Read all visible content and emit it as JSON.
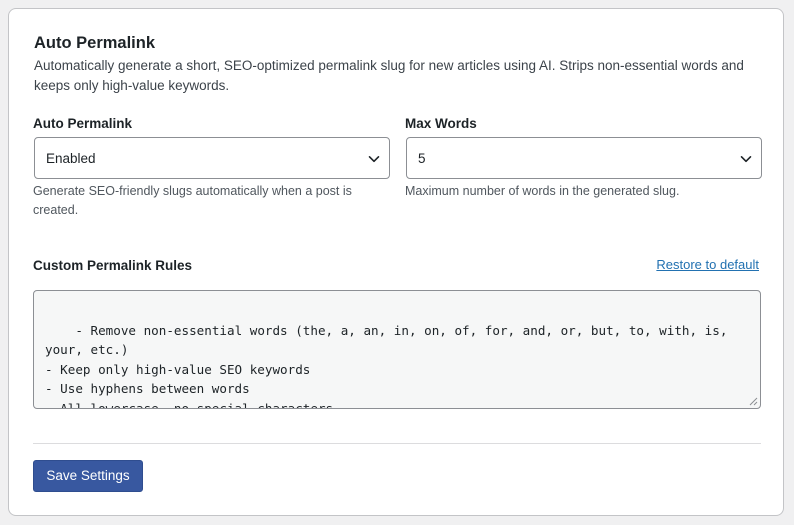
{
  "section": {
    "title": "Auto Permalink",
    "description": "Automatically generate a short, SEO-optimized permalink slug for new articles using AI. Strips non-essential words and keeps only high-value keywords."
  },
  "fields": {
    "auto_permalink": {
      "label": "Auto Permalink",
      "value": "Enabled",
      "help": "Generate SEO-friendly slugs automatically when a post is created."
    },
    "max_words": {
      "label": "Max Words",
      "value": "5",
      "help": "Maximum number of words in the generated slug."
    }
  },
  "rules": {
    "label": "Custom Permalink Rules",
    "restore_label": "Restore to default",
    "text": "- Remove non-essential words (the, a, an, in, on, of, for, and, or, but, to, with, is, your, etc.)\n- Keep only high-value SEO keywords\n- Use hyphens between words\n- All lowercase, no special characters"
  },
  "actions": {
    "save_label": "Save Settings"
  },
  "colors": {
    "primary_button": "#3858a0",
    "link": "#2271b1",
    "textarea_bg": "#f6f7f7"
  },
  "icons": {
    "select_chevron": "chevron-down-icon",
    "textarea_resize": "resize-handle-icon"
  }
}
